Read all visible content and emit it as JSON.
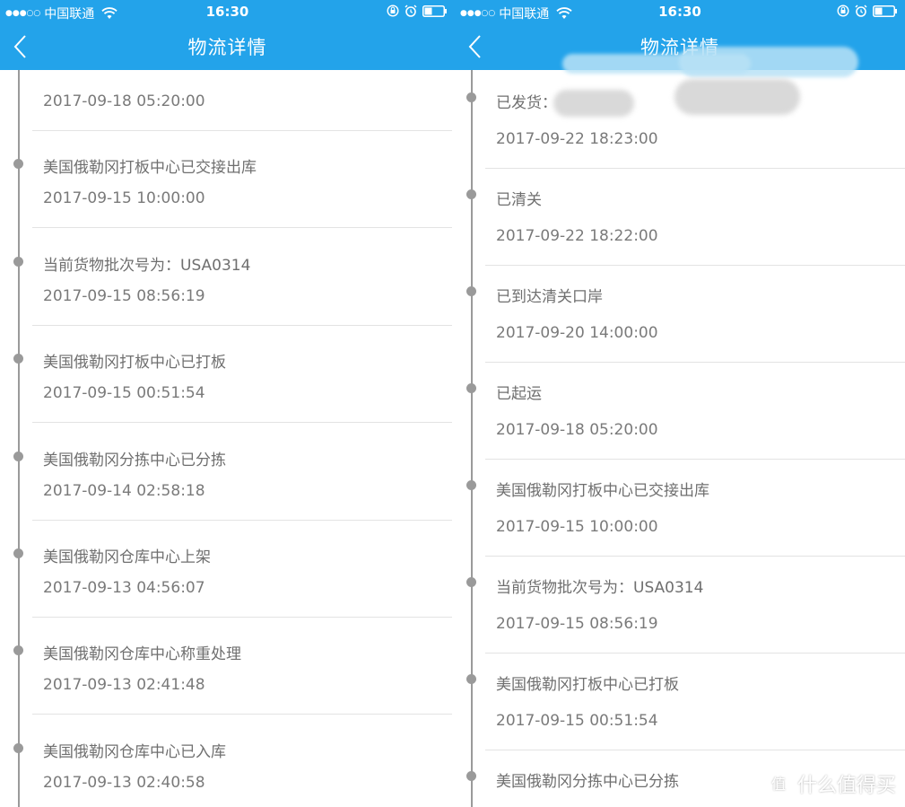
{
  "status_bar": {
    "carrier": "中国联通",
    "time": "16:30"
  },
  "nav": {
    "title": "物流详情"
  },
  "colors": {
    "header_bg": "#23a3ea",
    "timeline": "#9a9a9a",
    "separator": "#e3e3e3",
    "text_status": "#6f6f6f",
    "text_time": "#7a7a7a"
  },
  "left_screen": {
    "items": [
      {
        "status": "",
        "time": "2017-09-18 05:20:00"
      },
      {
        "status": "美国俄勒冈打板中心已交接出库",
        "time": "2017-09-15 10:00:00"
      },
      {
        "status": "当前货物批次号为：USA0314",
        "time": "2017-09-15 08:56:19"
      },
      {
        "status": "美国俄勒冈打板中心已打板",
        "time": "2017-09-15 00:51:54"
      },
      {
        "status": "美国俄勒冈分拣中心已分拣",
        "time": "2017-09-14 02:58:18"
      },
      {
        "status": "美国俄勒冈仓库中心上架",
        "time": "2017-09-13 04:56:07"
      },
      {
        "status": "美国俄勒冈仓库中心称重处理",
        "time": "2017-09-13 02:41:48"
      },
      {
        "status": "美国俄勒冈仓库中心已入库",
        "time": "2017-09-13 02:40:58"
      }
    ]
  },
  "right_screen": {
    "items": [
      {
        "status": "已发货：",
        "time": "2017-09-22 18:23:00"
      },
      {
        "status": "已清关",
        "time": "2017-09-22 18:22:00"
      },
      {
        "status": "已到达清关口岸",
        "time": "2017-09-20 14:00:00"
      },
      {
        "status": "已起运",
        "time": "2017-09-18 05:20:00"
      },
      {
        "status": "美国俄勒冈打板中心已交接出库",
        "time": "2017-09-15 10:00:00"
      },
      {
        "status": "当前货物批次号为：USA0314",
        "time": "2017-09-15 08:56:19"
      },
      {
        "status": "美国俄勒冈打板中心已打板",
        "time": "2017-09-15 00:51:54"
      },
      {
        "status": "美国俄勒冈分拣中心已分拣",
        "time": ""
      }
    ]
  },
  "watermark": {
    "text": "什么值得买"
  }
}
